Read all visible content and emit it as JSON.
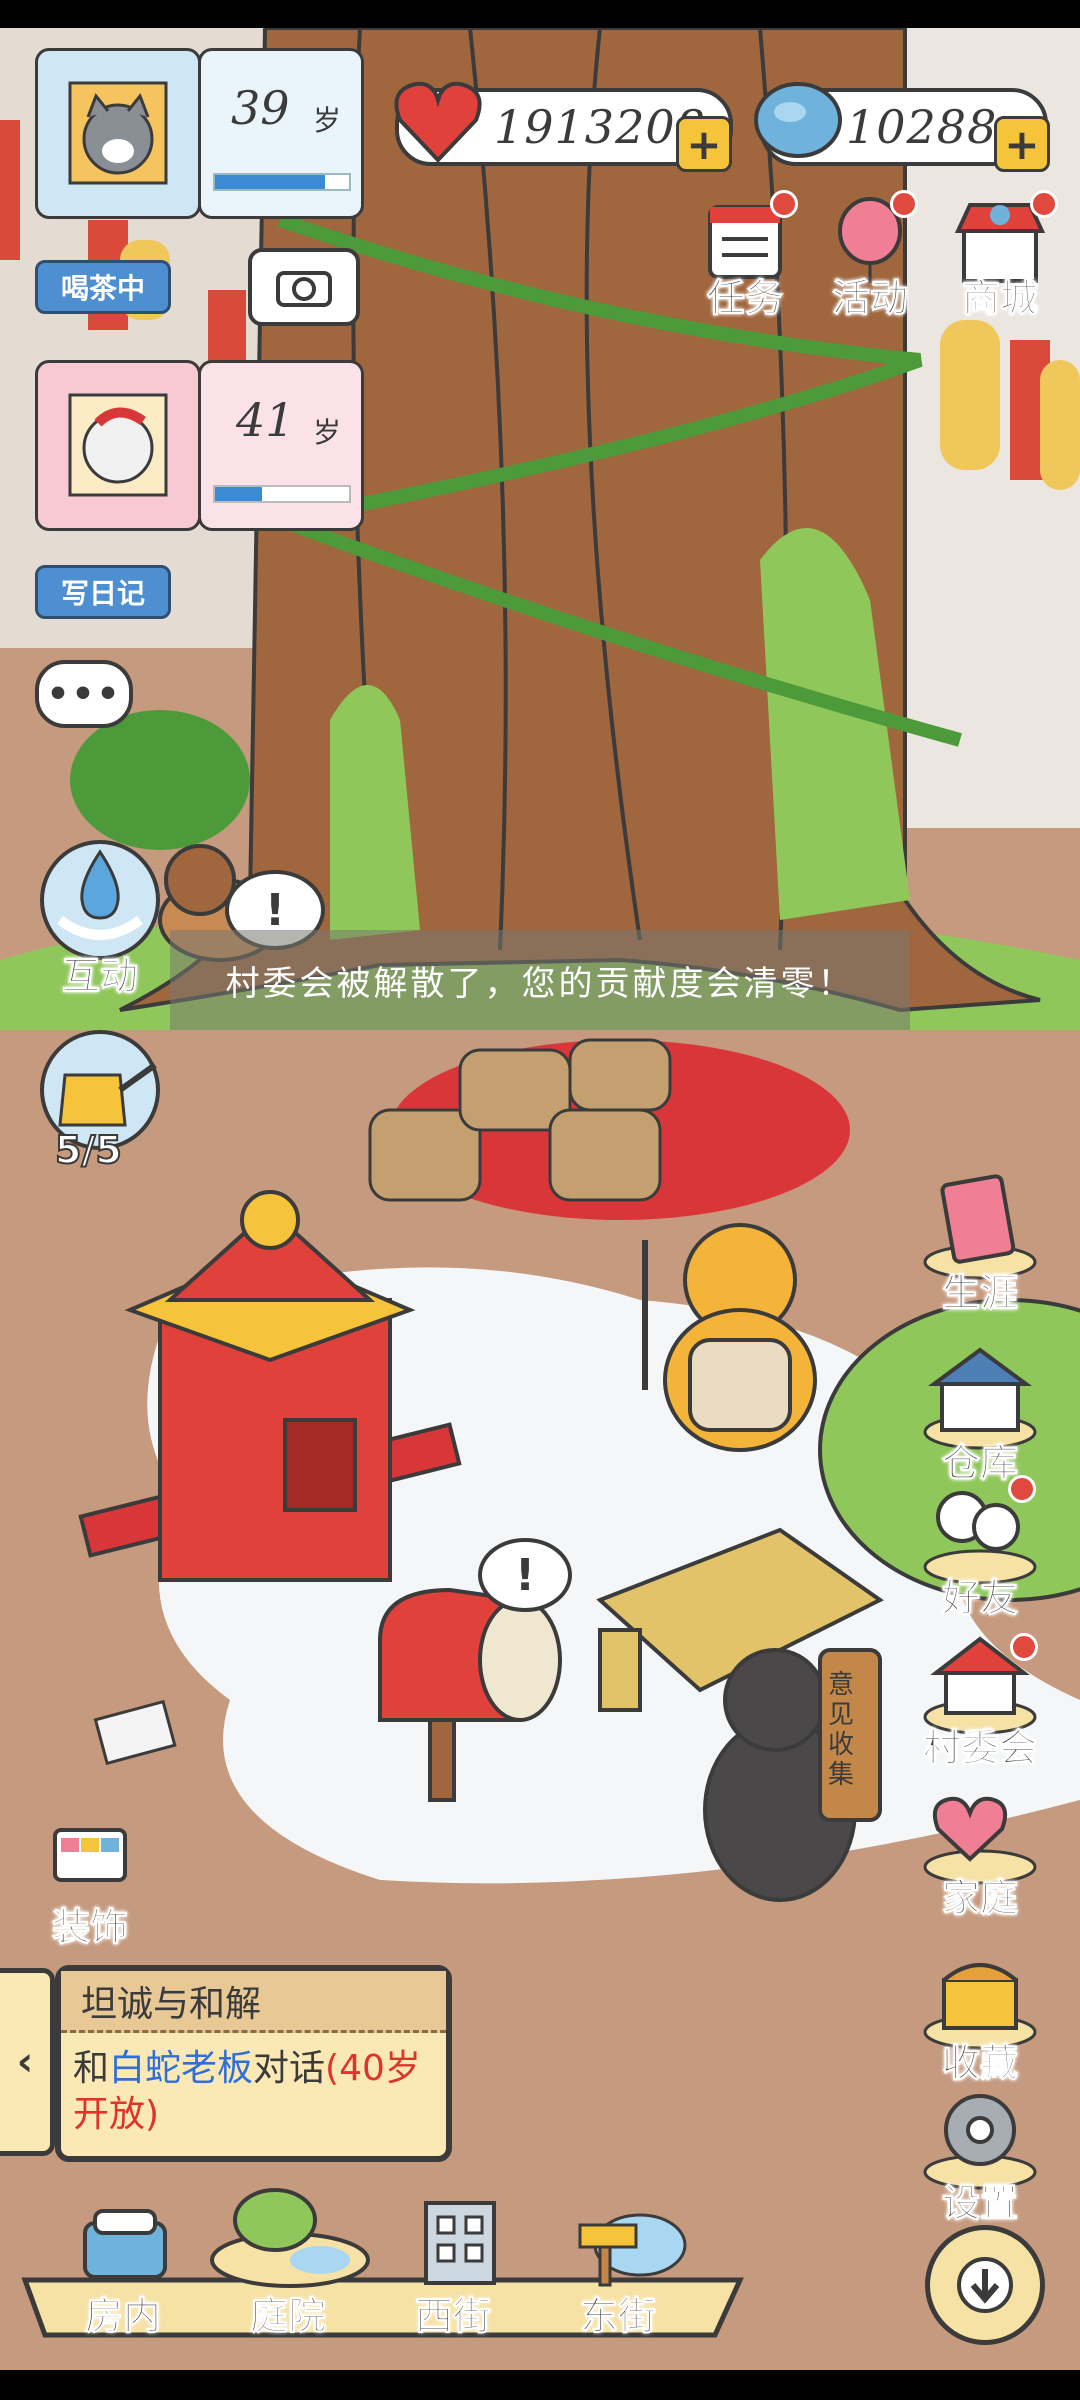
{
  "profiles": [
    {
      "age": "39",
      "age_unit": "岁",
      "status": "喝茶中",
      "progress": 0.82
    },
    {
      "age": "41",
      "age_unit": "岁",
      "status": "写日记",
      "progress": 0.35
    }
  ],
  "resources": {
    "hearts": "1913208",
    "gems": "10288"
  },
  "top_menu": {
    "tasks": "任务",
    "events": "活动",
    "shop": "商城"
  },
  "left_actions": {
    "interact": "互动",
    "water_count": "5/5"
  },
  "notice": "村委会被解散了，您的贡献度会清零！",
  "right_menu": {
    "career": "生涯",
    "warehouse": "仓库",
    "friends": "好友",
    "committee": "村委会",
    "family": "家庭",
    "collection": "收藏",
    "settings": "设置"
  },
  "decorate": "装饰",
  "quest": {
    "title": "坦诚与和解",
    "prefix": "和",
    "npc": "白蛇老板",
    "suffix": "对话",
    "condition": "(40岁开放)"
  },
  "bear_sign": "意见收集",
  "bottom_nav": {
    "indoor": "房内",
    "yard": "庭院",
    "west": "西街",
    "east": "东街"
  },
  "colors": {
    "accent_blue": "#4d8fd1",
    "quest_red": "#e0332b",
    "quest_blue": "#2f6fd6",
    "ground": "#c59a7e"
  }
}
